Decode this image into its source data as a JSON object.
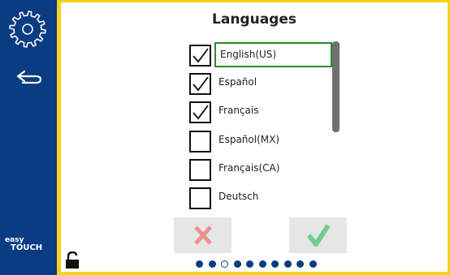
{
  "screen": {
    "title": "Languages"
  },
  "brand": {
    "line1": "easy",
    "line2": "TOUCH"
  },
  "languages": [
    {
      "label": "English(US)",
      "checked": true
    },
    {
      "label": "Español",
      "checked": true
    },
    {
      "label": "Français",
      "checked": true
    },
    {
      "label": "Español(MX)",
      "checked": false
    },
    {
      "label": "Français(CA)",
      "checked": false
    },
    {
      "label": "Deutsch",
      "checked": false
    }
  ],
  "focused_index": 0,
  "page_indicator": {
    "count": 10,
    "current": 3
  },
  "icons": {
    "settings": "gear-icon",
    "back": "back-arrow-icon",
    "cancel": "x-icon",
    "confirm": "checkmark-icon",
    "lock": "unlocked-padlock-icon"
  },
  "colors": {
    "sidebar": "#0a3c82",
    "accent_yellow": "#f7d21a",
    "cancel_red": "#ee8f8f",
    "confirm_green": "#6fce8e",
    "focus_green": "#2a8a2a",
    "dot_active": "#0a3c82"
  }
}
